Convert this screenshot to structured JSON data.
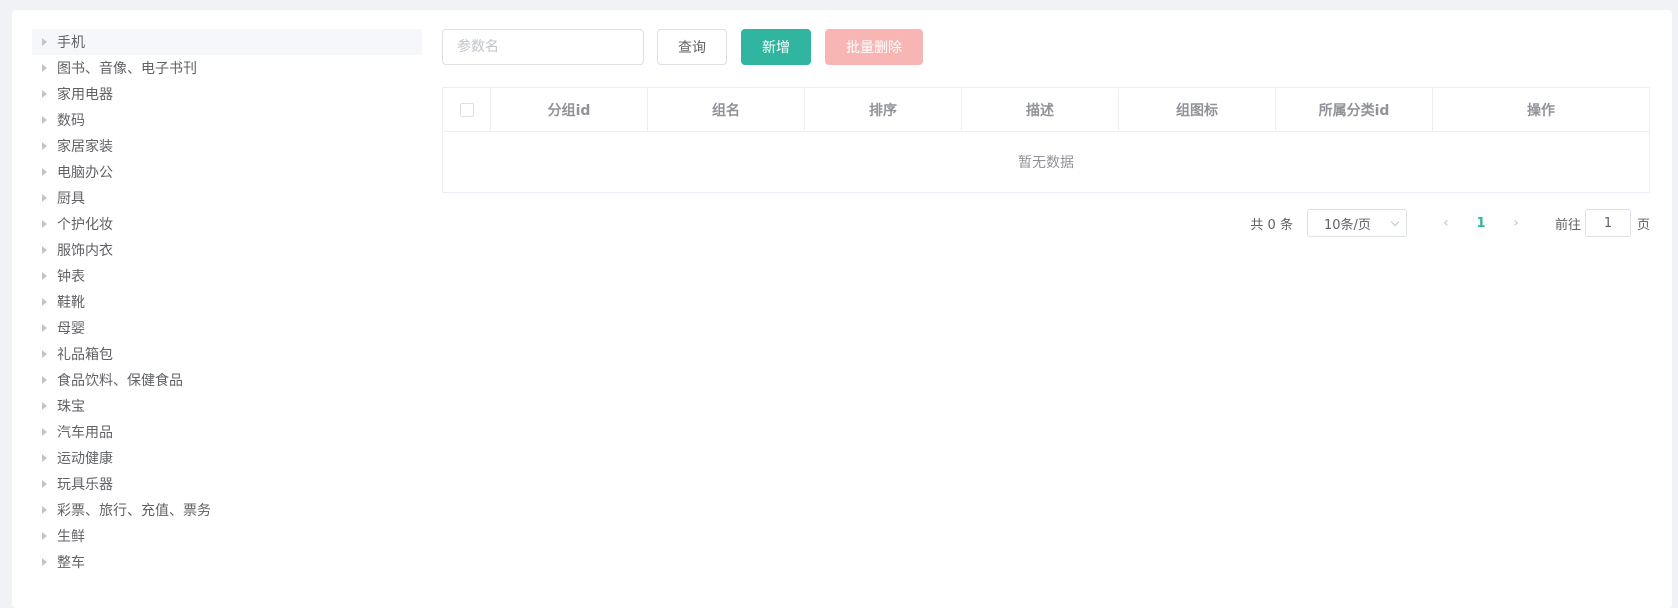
{
  "tree": {
    "items": [
      {
        "label": "手机"
      },
      {
        "label": "图书、音像、电子书刊"
      },
      {
        "label": "家用电器"
      },
      {
        "label": "数码"
      },
      {
        "label": "家居家装"
      },
      {
        "label": "电脑办公"
      },
      {
        "label": "厨具"
      },
      {
        "label": "个护化妆"
      },
      {
        "label": "服饰内衣"
      },
      {
        "label": "钟表"
      },
      {
        "label": "鞋靴"
      },
      {
        "label": "母婴"
      },
      {
        "label": "礼品箱包"
      },
      {
        "label": "食品饮料、保健食品"
      },
      {
        "label": "珠宝"
      },
      {
        "label": "汽车用品"
      },
      {
        "label": "运动健康"
      },
      {
        "label": "玩具乐器"
      },
      {
        "label": "彩票、旅行、充值、票务"
      },
      {
        "label": "生鲜"
      },
      {
        "label": "整车"
      }
    ]
  },
  "toolbar": {
    "search_placeholder": "参数名",
    "search_value": "",
    "query_label": "查询",
    "add_label": "新增",
    "batch_delete_label": "批量删除"
  },
  "table": {
    "columns": [
      "分组id",
      "组名",
      "排序",
      "描述",
      "组图标",
      "所属分类id",
      "操作"
    ],
    "empty_text": "暂无数据"
  },
  "pagination": {
    "total_text": "共 0 条",
    "page_size": "10条/页",
    "current_page": "1",
    "goto_prefix": "前往",
    "goto_value": "1",
    "goto_suffix": "页"
  },
  "colors": {
    "primary": "#2fb5a0",
    "danger_disabled": "#f7b5b3"
  }
}
